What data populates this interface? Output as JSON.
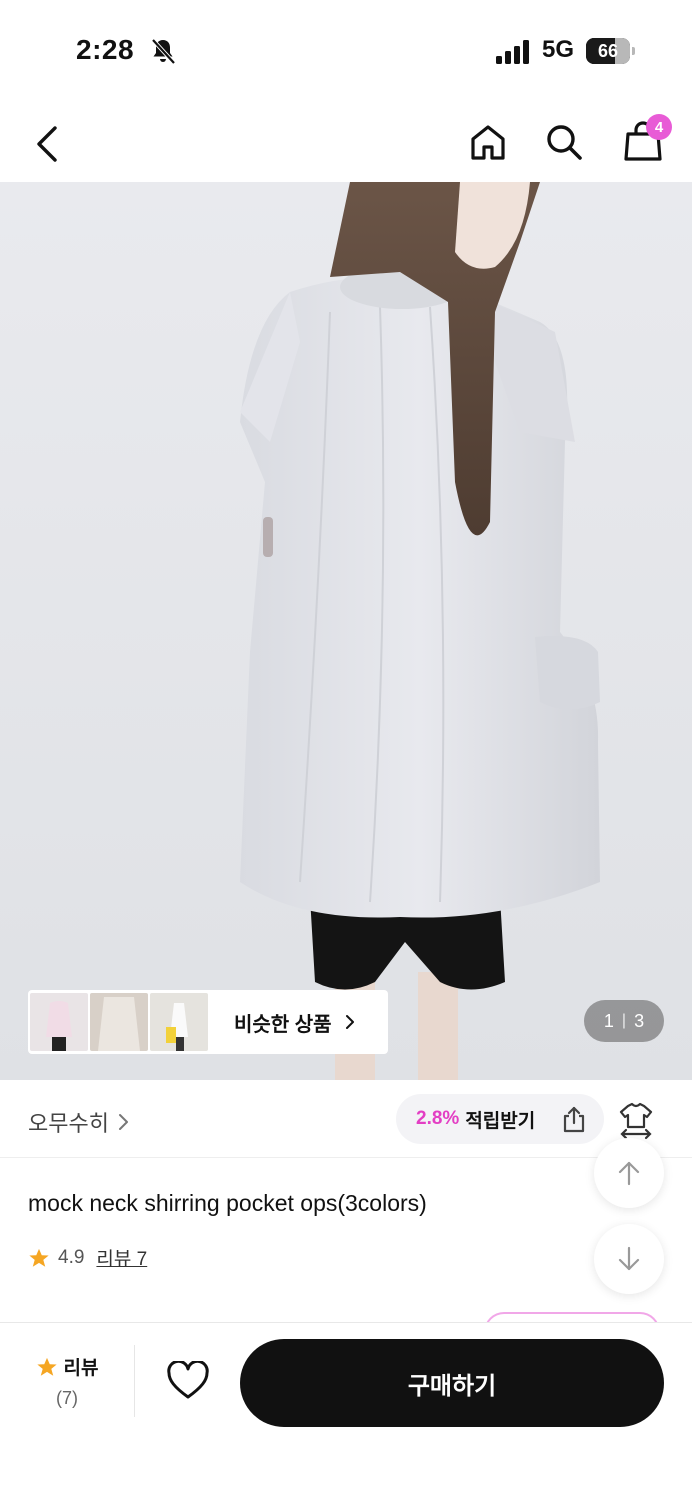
{
  "status": {
    "time": "2:28",
    "network": "5G",
    "battery": "66",
    "battery_level": 0.66
  },
  "header": {
    "cart_count": "4"
  },
  "gallery": {
    "similar_label": "비슷한 상품",
    "page_current": "1",
    "page_separator": "|",
    "page_total": "3"
  },
  "brand": {
    "name": "오무수히",
    "reward_percent": "2.8%",
    "reward_label": "적립받기"
  },
  "product": {
    "title": "mock neck shirring pocket ops(3colors)",
    "rating": "4.9",
    "review_link": "리뷰 7"
  },
  "bottom": {
    "review_label": "리뷰",
    "review_count": "(7)",
    "buy_label": "구매하기"
  },
  "colors": {
    "accent_pink": "#e33ec4",
    "badge_pink": "#e85bd6",
    "star_orange": "#f5a623",
    "buy_button": "#111111"
  }
}
